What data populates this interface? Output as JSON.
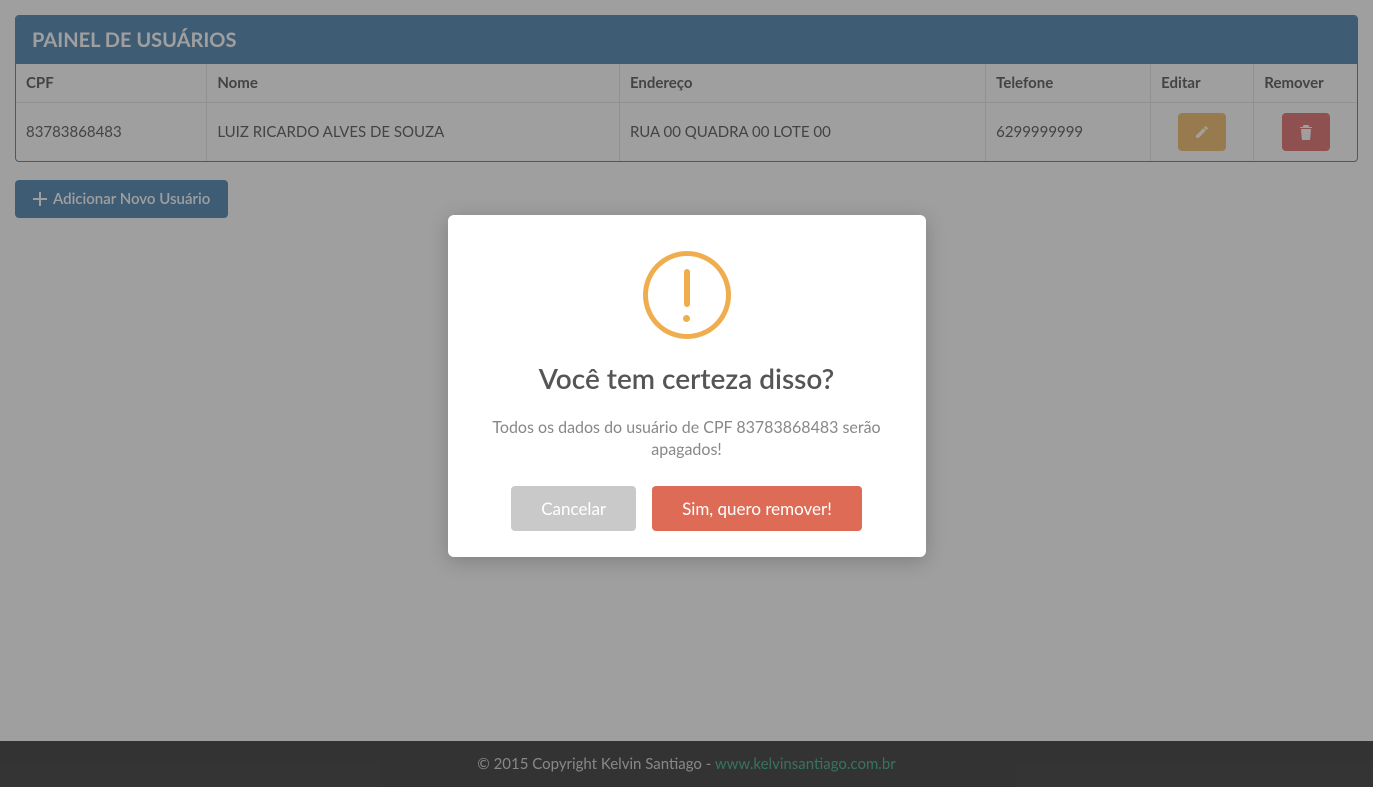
{
  "panel": {
    "title": "PAINEL DE USUÁRIOS"
  },
  "table": {
    "headers": {
      "cpf": "CPF",
      "nome": "Nome",
      "endereco": "Endereço",
      "telefone": "Telefone",
      "editar": "Editar",
      "remover": "Remover"
    },
    "rows": [
      {
        "cpf": "83783868483",
        "nome": "LUIZ RICARDO ALVES DE SOUZA",
        "endereco": "RUA 00 QUADRA 00 LOTE 00",
        "telefone": "6299999999"
      }
    ]
  },
  "add_button": {
    "label": "Adicionar Novo Usuário"
  },
  "modal": {
    "title": "Você tem certeza disso?",
    "text": "Todos os dados do usuário de CPF 83783868483 serão apagados!",
    "cancel": "Cancelar",
    "confirm": "Sim, quero remover!"
  },
  "footer": {
    "copyright": "© 2015 Copyright Kelvin Santiago - ",
    "link_text": "www.kelvinsantiago.com.br"
  },
  "icons": {
    "plus": "plus-icon",
    "pencil": "pencil-icon",
    "trash": "trash-icon",
    "warning": "warning-icon"
  },
  "colors": {
    "primary": "#2b6ca3",
    "warning": "#f0ad4e",
    "danger": "#d9534f",
    "modal_confirm": "#dd6b55",
    "link": "#1a9e74"
  }
}
